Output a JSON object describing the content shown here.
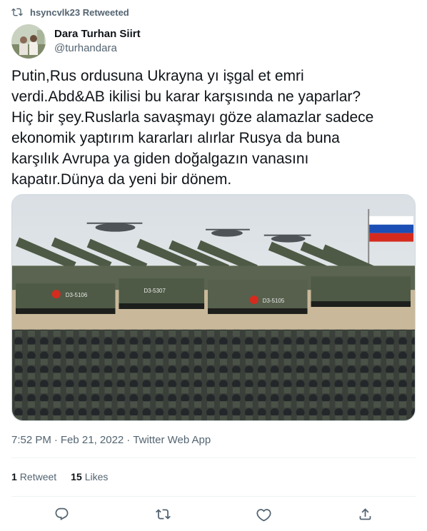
{
  "retweet": {
    "text": "hsyncvlk23 Retweeted",
    "icon": "retweet-icon"
  },
  "author": {
    "display_name": "Dara Turhan Siirt",
    "handle": "@turhandara"
  },
  "tweet": {
    "text": "Putin,Rus ordusuna Ukrayna yı işgal et emri\nverdi.Abd&AB ikilisi bu karar karşısında ne yaparlar?\nHiç bir şey.Ruslarla savaşmayı göze alamazlar sadece\nekonomik yaptırım kararları alırlar Rusya da buna\nkarşılık Avrupa ya giden doğalgazın vanasını\nkapatır.Dünya da yeni bir dönem.",
    "image": {
      "labels": [
        "D3-5106",
        "D3-5307",
        "D3-5105"
      ]
    }
  },
  "meta": {
    "time": "7:52 PM",
    "separator1": "·",
    "date": "Feb 21, 2022",
    "separator2": "·",
    "source": "Twitter Web App"
  },
  "stats": {
    "retweet_count": "1",
    "retweet_label": "Retweet",
    "likes_count": "15",
    "likes_label": "Likes"
  },
  "actions": [
    {
      "name": "reply",
      "icon": "reply-icon"
    },
    {
      "name": "retweet",
      "icon": "retweet-icon"
    },
    {
      "name": "like",
      "icon": "heart-icon"
    },
    {
      "name": "share",
      "icon": "share-icon"
    }
  ],
  "colors": {
    "text": "#0f1419",
    "secondary": "#536471",
    "border": "#cfd9de",
    "divider": "#eff3f4"
  }
}
